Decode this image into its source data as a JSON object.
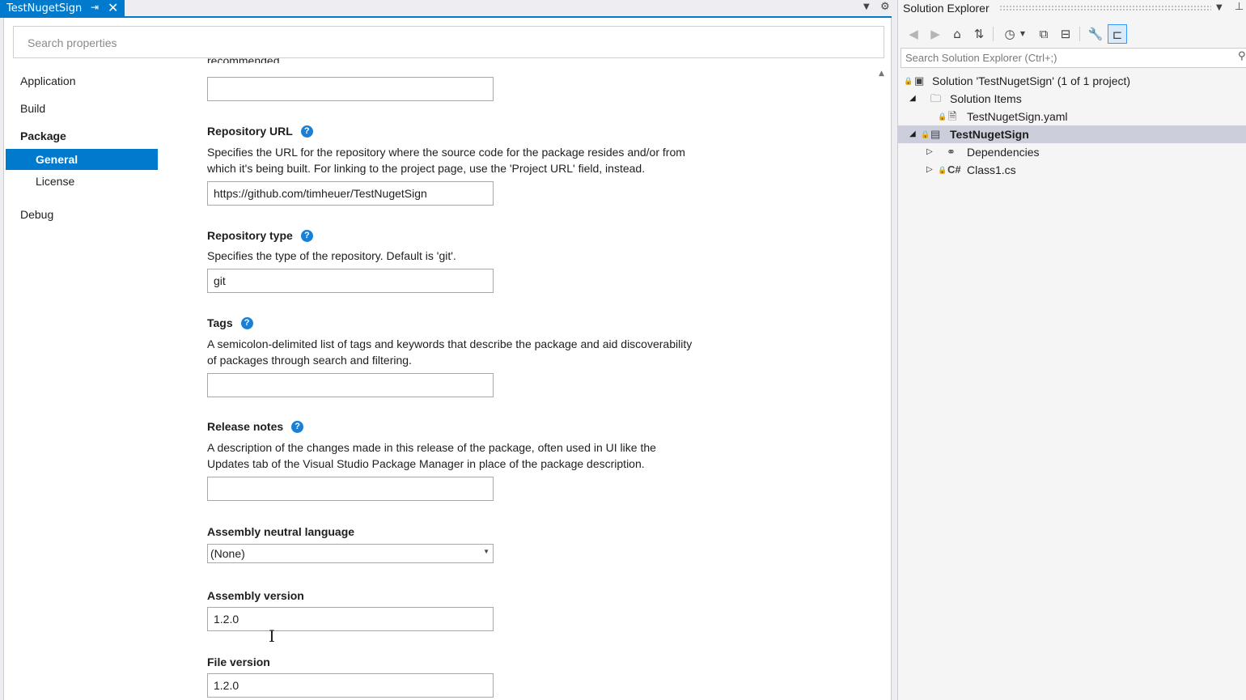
{
  "doc_tab": {
    "title": "TestNugetSign"
  },
  "properties": {
    "search_placeholder": "Search properties",
    "nav": {
      "application": "Application",
      "build": "Build",
      "package": "Package",
      "general": "General",
      "license": "License",
      "debug": "Debug"
    },
    "fields": {
      "cut_text": "recommended.",
      "repo_url_title": "Repository URL",
      "repo_url_desc": "Specifies the URL for the repository where the source code for the package resides and/or from which it's being built. For linking to the project page, use the 'Project URL' field, instead.",
      "repo_url_value": "https://github.com/timheuer/TestNugetSign",
      "repo_type_title": "Repository type",
      "repo_type_desc": "Specifies the type of the repository. Default is 'git'.",
      "repo_type_value": "git",
      "tags_title": "Tags",
      "tags_desc": "A semicolon-delimited list of tags and keywords that describe the package and aid discoverability of packages through search and filtering.",
      "tags_value": "",
      "release_notes_title": "Release notes",
      "release_notes_desc": "A description of the changes made in this release of the package, often used in UI like the Updates tab of the Visual Studio Package Manager in place of the package description.",
      "release_notes_value": "",
      "neutral_lang_title": "Assembly neutral language",
      "neutral_lang_value": "(None)",
      "assembly_version_title": "Assembly version",
      "assembly_version_value": "1.2.0",
      "file_version_title": "File version",
      "file_version_value": "1.2.0"
    }
  },
  "solution_explorer": {
    "title": "Solution Explorer",
    "search_placeholder": "Search Solution Explorer (Ctrl+;)",
    "tree": {
      "solution": "Solution 'TestNugetSign' (1 of 1 project)",
      "solution_items": "Solution Items",
      "yaml": "TestNugetSign.yaml",
      "project": "TestNugetSign",
      "dependencies": "Dependencies",
      "class1": "Class1.cs"
    }
  }
}
